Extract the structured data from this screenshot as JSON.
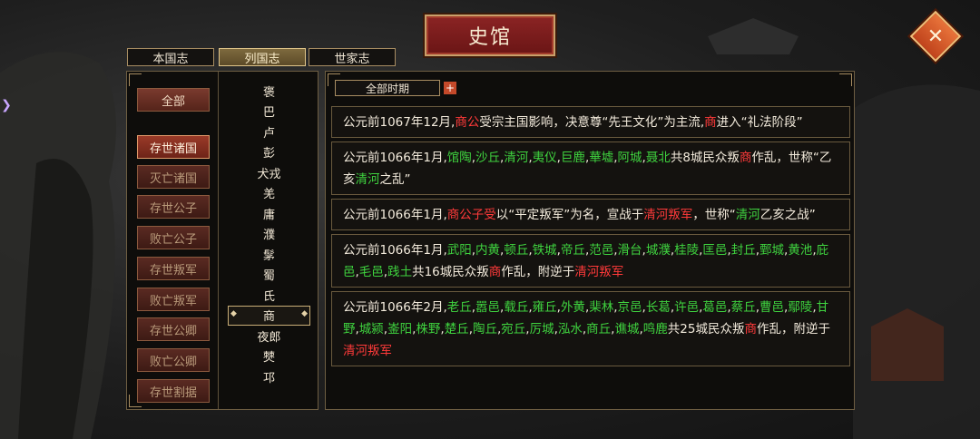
{
  "title": "史馆",
  "close_label": "✕",
  "edge_arrow": "❯",
  "tabs": [
    {
      "label": "本国志",
      "active": false
    },
    {
      "label": "列国志",
      "active": true
    },
    {
      "label": "世家志",
      "active": false
    }
  ],
  "categories": {
    "all": "全部",
    "items": [
      {
        "label": "存世诸国",
        "active": true
      },
      {
        "label": "灭亡诸国",
        "active": false
      },
      {
        "label": "存世公子",
        "active": false
      },
      {
        "label": "败亡公子",
        "active": false
      },
      {
        "label": "存世叛军",
        "active": false
      },
      {
        "label": "败亡叛军",
        "active": false
      },
      {
        "label": "存世公卿",
        "active": false
      },
      {
        "label": "败亡公卿",
        "active": false
      },
      {
        "label": "存世割据",
        "active": false
      }
    ]
  },
  "states": [
    "褒",
    "巴",
    "卢",
    "彭",
    "犬戎",
    "羌",
    "庸",
    "濮",
    "髳",
    "蜀",
    "氏",
    "商",
    "夜郎",
    "僰",
    "邛"
  ],
  "selected_state": "商",
  "period_filter": {
    "label": "全部时期",
    "plus": "+"
  },
  "entries": [
    {
      "segments": [
        {
          "t": "公元前1067年12月,",
          "c": ""
        },
        {
          "t": "商公",
          "c": "red"
        },
        {
          "t": "受宗主国影响，决意尊“先王文化”为主流,",
          "c": ""
        },
        {
          "t": "商",
          "c": "red"
        },
        {
          "t": "进入“礼法阶段”",
          "c": ""
        }
      ]
    },
    {
      "segments": [
        {
          "t": "公元前1066年1月,",
          "c": ""
        },
        {
          "t": "馆陶",
          "c": "green"
        },
        {
          "t": ",",
          "c": ""
        },
        {
          "t": "沙丘",
          "c": "green"
        },
        {
          "t": ",",
          "c": ""
        },
        {
          "t": "清河",
          "c": "green"
        },
        {
          "t": ",",
          "c": ""
        },
        {
          "t": "夷仪",
          "c": "green"
        },
        {
          "t": ",",
          "c": ""
        },
        {
          "t": "巨鹿",
          "c": "green"
        },
        {
          "t": ",",
          "c": ""
        },
        {
          "t": "華墟",
          "c": "green"
        },
        {
          "t": ",",
          "c": ""
        },
        {
          "t": "阿城",
          "c": "green"
        },
        {
          "t": ",",
          "c": ""
        },
        {
          "t": "聂北",
          "c": "green"
        },
        {
          "t": "共8城民众叛",
          "c": ""
        },
        {
          "t": "商",
          "c": "red"
        },
        {
          "t": "作乱，世称“乙亥",
          "c": ""
        },
        {
          "t": "清河",
          "c": "green"
        },
        {
          "t": "之乱”",
          "c": ""
        }
      ]
    },
    {
      "segments": [
        {
          "t": "公元前1066年1月,",
          "c": ""
        },
        {
          "t": "商公子受",
          "c": "red"
        },
        {
          "t": "以“平定叛军”为名，宣战于",
          "c": ""
        },
        {
          "t": "清河叛军",
          "c": "red"
        },
        {
          "t": "，世称“",
          "c": ""
        },
        {
          "t": "清河",
          "c": "green"
        },
        {
          "t": "乙亥之战”",
          "c": ""
        }
      ]
    },
    {
      "segments": [
        {
          "t": "公元前1066年1月,",
          "c": ""
        },
        {
          "t": "武阳",
          "c": "green"
        },
        {
          "t": ",",
          "c": ""
        },
        {
          "t": "内黄",
          "c": "green"
        },
        {
          "t": ",",
          "c": ""
        },
        {
          "t": "顿丘",
          "c": "green"
        },
        {
          "t": ",",
          "c": ""
        },
        {
          "t": "铁城",
          "c": "green"
        },
        {
          "t": ",",
          "c": ""
        },
        {
          "t": "帝丘",
          "c": "green"
        },
        {
          "t": ",",
          "c": ""
        },
        {
          "t": "范邑",
          "c": "green"
        },
        {
          "t": ",",
          "c": ""
        },
        {
          "t": "滑台",
          "c": "green"
        },
        {
          "t": ",",
          "c": ""
        },
        {
          "t": "城濮",
          "c": "green"
        },
        {
          "t": ",",
          "c": ""
        },
        {
          "t": "桂陵",
          "c": "green"
        },
        {
          "t": ",",
          "c": ""
        },
        {
          "t": "匡邑",
          "c": "green"
        },
        {
          "t": ",",
          "c": ""
        },
        {
          "t": "封丘",
          "c": "green"
        },
        {
          "t": ",",
          "c": ""
        },
        {
          "t": "鄄城",
          "c": "green"
        },
        {
          "t": ",",
          "c": ""
        },
        {
          "t": "黄池",
          "c": "green"
        },
        {
          "t": ",",
          "c": ""
        },
        {
          "t": "庇邑",
          "c": "green"
        },
        {
          "t": ",",
          "c": ""
        },
        {
          "t": "毛邑",
          "c": "green"
        },
        {
          "t": ",",
          "c": ""
        },
        {
          "t": "践土",
          "c": "green"
        },
        {
          "t": "共16城民众叛",
          "c": ""
        },
        {
          "t": "商",
          "c": "red"
        },
        {
          "t": "作乱，附逆于",
          "c": ""
        },
        {
          "t": "清河叛军",
          "c": "red"
        }
      ]
    },
    {
      "segments": [
        {
          "t": "公元前1066年2月,",
          "c": ""
        },
        {
          "t": "老丘",
          "c": "green"
        },
        {
          "t": ",",
          "c": ""
        },
        {
          "t": "嚣邑",
          "c": "green"
        },
        {
          "t": ",",
          "c": ""
        },
        {
          "t": "载丘",
          "c": "green"
        },
        {
          "t": ",",
          "c": ""
        },
        {
          "t": "雍丘",
          "c": "green"
        },
        {
          "t": ",",
          "c": ""
        },
        {
          "t": "外黄",
          "c": "green"
        },
        {
          "t": ",",
          "c": ""
        },
        {
          "t": "棐林",
          "c": "green"
        },
        {
          "t": ",",
          "c": ""
        },
        {
          "t": "京邑",
          "c": "green"
        },
        {
          "t": ",",
          "c": ""
        },
        {
          "t": "长葛",
          "c": "green"
        },
        {
          "t": ",",
          "c": ""
        },
        {
          "t": "许邑",
          "c": "green"
        },
        {
          "t": ",",
          "c": ""
        },
        {
          "t": "葛邑",
          "c": "green"
        },
        {
          "t": ",",
          "c": ""
        },
        {
          "t": "蔡丘",
          "c": "green"
        },
        {
          "t": ",",
          "c": ""
        },
        {
          "t": "曹邑",
          "c": "green"
        },
        {
          "t": ",",
          "c": ""
        },
        {
          "t": "鄢陵",
          "c": "green"
        },
        {
          "t": ",",
          "c": ""
        },
        {
          "t": "甘野",
          "c": "green"
        },
        {
          "t": ",",
          "c": ""
        },
        {
          "t": "城颍",
          "c": "green"
        },
        {
          "t": ",",
          "c": ""
        },
        {
          "t": "崟阳",
          "c": "green"
        },
        {
          "t": ",",
          "c": ""
        },
        {
          "t": "株野",
          "c": "green"
        },
        {
          "t": ",",
          "c": ""
        },
        {
          "t": "楚丘",
          "c": "green"
        },
        {
          "t": ",",
          "c": ""
        },
        {
          "t": "陶丘",
          "c": "green"
        },
        {
          "t": ",",
          "c": ""
        },
        {
          "t": "宛丘",
          "c": "green"
        },
        {
          "t": ",",
          "c": ""
        },
        {
          "t": "厉城",
          "c": "green"
        },
        {
          "t": ",",
          "c": ""
        },
        {
          "t": "泓水",
          "c": "green"
        },
        {
          "t": ",",
          "c": ""
        },
        {
          "t": "商丘",
          "c": "green"
        },
        {
          "t": ",",
          "c": ""
        },
        {
          "t": "谯城",
          "c": "green"
        },
        {
          "t": ",",
          "c": ""
        },
        {
          "t": "鸣鹿",
          "c": "green"
        },
        {
          "t": "共25城民众叛",
          "c": ""
        },
        {
          "t": "商",
          "c": "red"
        },
        {
          "t": "作乱，附逆于",
          "c": ""
        },
        {
          "t": "清河叛军",
          "c": "red"
        }
      ]
    }
  ]
}
